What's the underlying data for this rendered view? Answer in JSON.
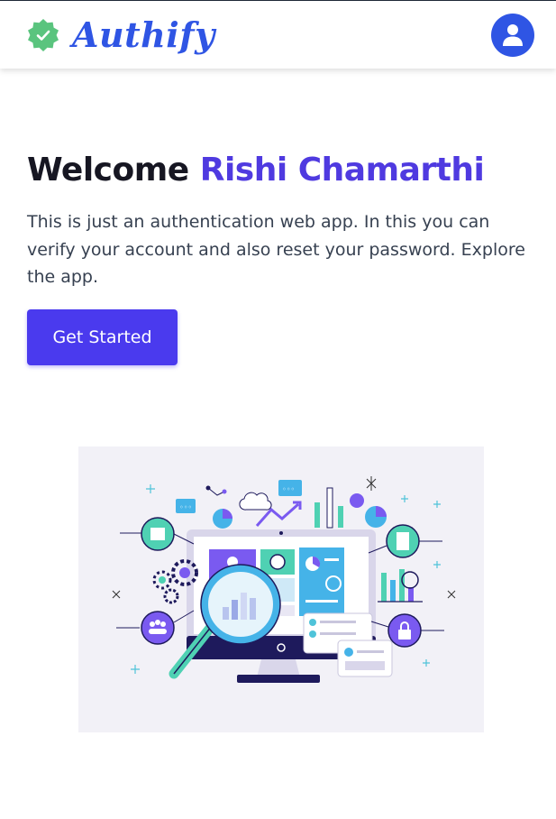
{
  "navbar": {
    "brand_name": "Authify",
    "badge_icon": "verified-badge-icon",
    "avatar_icon": "user-icon",
    "colors": {
      "brand": "#2f55e4",
      "badge": "#5ac47e"
    }
  },
  "hero": {
    "greeting": "Welcome",
    "user_name": "Rishi Chamarthi",
    "description": "This is just an authentication web app. In this you can verify your account and also reset your password. Explore the app.",
    "cta_label": "Get Started",
    "colors": {
      "accent": "#4f3ae0",
      "button": "#4a3aee"
    }
  },
  "illustration": {
    "icon": "data-analytics-illustration"
  }
}
